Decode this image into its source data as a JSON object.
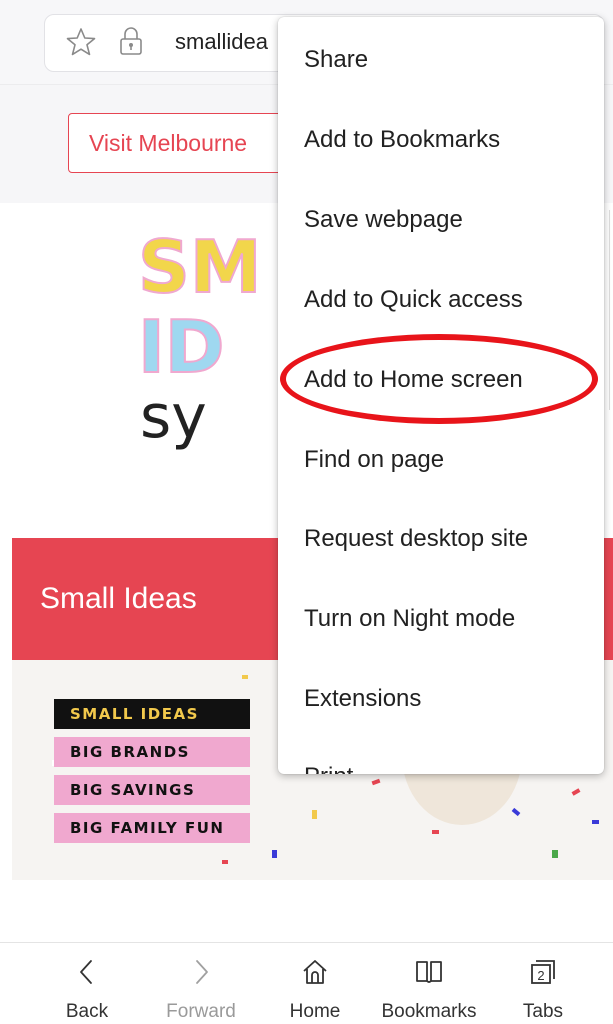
{
  "address_bar": {
    "url_text": "smallidea"
  },
  "page": {
    "visit_button": "Visit Melbourne",
    "logo": {
      "line1": "SM",
      "line2": "ID",
      "line3": "sy"
    },
    "banner_title": "Small Ideas",
    "tags": [
      "SMALL IDEAS",
      "BIG BRANDS",
      "BIG SAVINGS",
      "BIG FAMILY FUN"
    ]
  },
  "menu": {
    "items": [
      "Share",
      "Add to Bookmarks",
      "Save webpage",
      "Add to Quick access",
      "Add to Home screen",
      "Find on page",
      "Request desktop site",
      "Turn on Night mode",
      "Extensions",
      "Print"
    ],
    "highlighted_item": "Add to Home screen",
    "highlight_color": "#e8141a"
  },
  "bottom_nav": {
    "items": [
      {
        "label": "Back",
        "icon": "back-icon"
      },
      {
        "label": "Forward",
        "icon": "forward-icon"
      },
      {
        "label": "Home",
        "icon": "home-icon"
      },
      {
        "label": "Bookmarks",
        "icon": "bookmarks-icon"
      },
      {
        "label": "Tabs",
        "icon": "tabs-icon",
        "count": "2"
      }
    ]
  },
  "colors": {
    "brand_red": "#e64552",
    "logo_yellow": "#f2d64b",
    "logo_pink": "#f0a8cf",
    "logo_blue": "#9fd8f0"
  }
}
